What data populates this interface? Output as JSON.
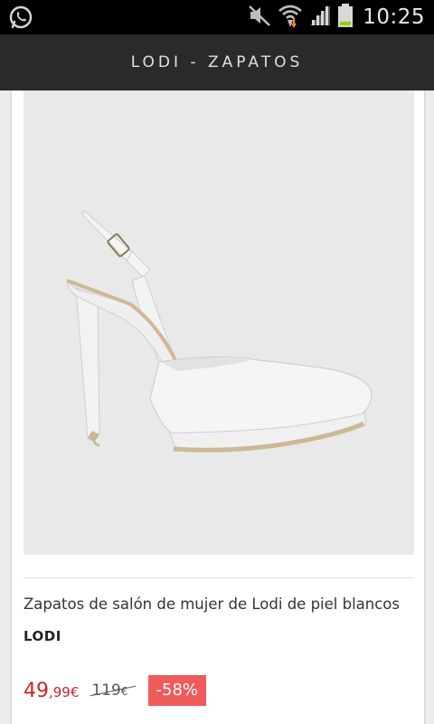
{
  "status_bar": {
    "time": "10:25",
    "icons": [
      "whatsapp-icon",
      "mute-icon",
      "wifi-icon",
      "signal-icon",
      "battery-icon"
    ]
  },
  "app_bar": {
    "title": "LODI - ZAPATOS"
  },
  "product": {
    "image_alt": "white-slingback-pump-shoe",
    "name": "Zapatos de salón de mujer de Lodi de piel blancos",
    "brand": "LODI",
    "price_int": "49",
    "price_dec": ",99€",
    "old_price_int": "119",
    "old_price_cur": "€",
    "discount": "-58%"
  },
  "colors": {
    "status_bar": "#000000",
    "app_bar": "#2a2a2a",
    "price": "#c1272d",
    "discount_badge": "#f05a5a"
  }
}
